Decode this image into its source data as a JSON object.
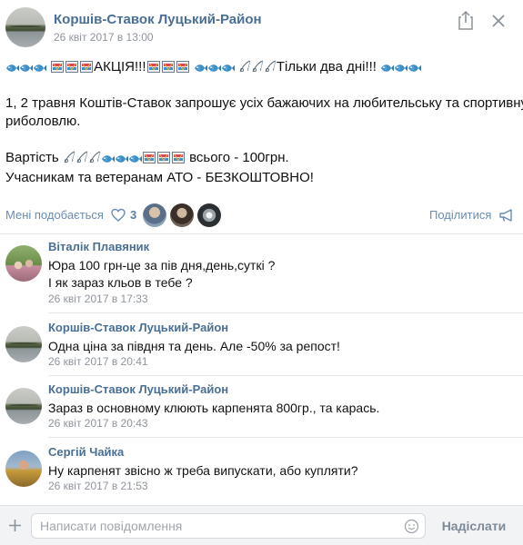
{
  "post": {
    "group_name": "Коршів-Ставок Луцький-Район",
    "date": "26 квіт 2017 в 13:00",
    "promo_word": "АКЦІЯ!!!",
    "two_days": "Тільки два дні!!!",
    "line2a": "1, 2 травня Коштів-Ставок запрошує усіх бажаючих на любительську та спортивну",
    "line2b": "риболовлю.",
    "price_prefix": "Вартість",
    "price_suffix": "всього - 100грн.",
    "veterans": "Учасникам та ветеранам АТО - БЕЗКОШТОВНО!"
  },
  "actions": {
    "likes_label": "Мені подобається",
    "likes_count": "3",
    "share_label": "Поділитися"
  },
  "comments": [
    {
      "author": "Віталік Плавяник",
      "lines": [
        "Юра 100 грн-це за пів дня,день,суткі ?",
        "І як зараз кльов в тебе ?"
      ],
      "time": "26 квіт 2017 в 17:33"
    },
    {
      "author": "Коршів-Ставок Луцький-Район",
      "lines": [
        "Одна ціна за півдня та день. Але -50% за репост!"
      ],
      "time": "26 квіт 2017 в 20:41"
    },
    {
      "author": "Коршів-Ставок Луцький-Район",
      "lines": [
        "Зараз в основному клюють карпенята 800гр., та карась."
      ],
      "time": "26 квіт 2017 в 20:43"
    },
    {
      "author": "Сергій Чайка",
      "lines": [
        "Ну карпенят звісно ж треба випускати, або купляти?"
      ],
      "time": "26 квіт 2017 в 21:53"
    }
  ],
  "composer": {
    "placeholder": "Написати повідомлення",
    "send_label": "Надіслати"
  },
  "colors": {
    "link_blue": "#4a6f94",
    "muted_gray": "#8f959c",
    "composer_bg": "#f2f3f5"
  }
}
